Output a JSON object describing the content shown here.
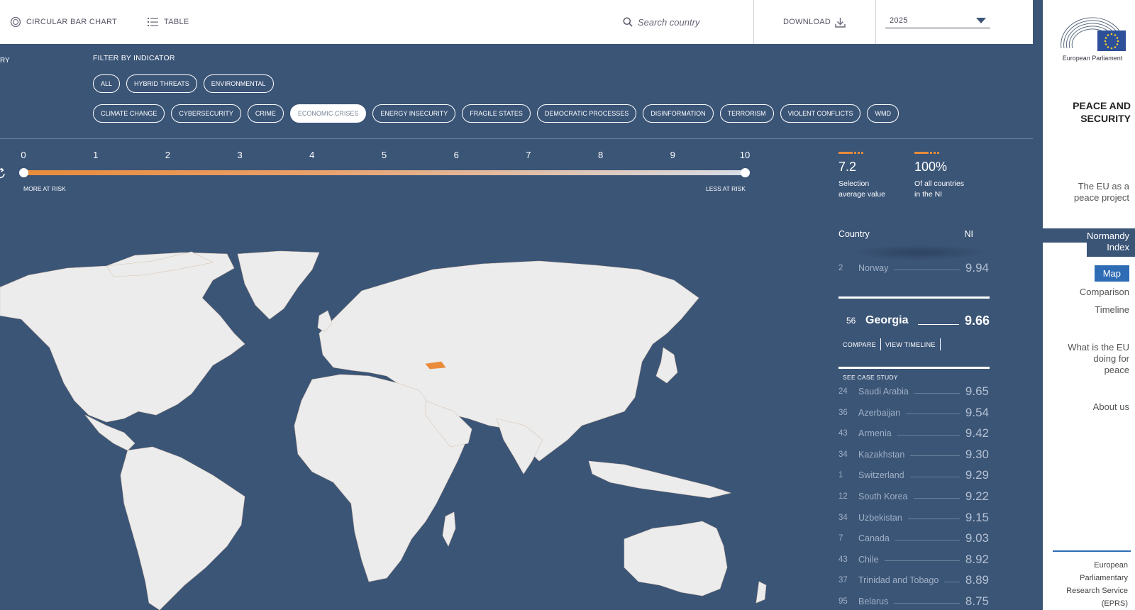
{
  "topbar": {
    "circular_label": "CIRCULAR BAR CHART",
    "table_label": "TABLE",
    "search_placeholder": "Search country",
    "download_label": "DOWNLOAD",
    "year": "2025"
  },
  "filters": {
    "cut_label": "RY",
    "heading": "FILTER BY INDICATOR",
    "row1": [
      "ALL",
      "HYBRID THREATS",
      "ENVIRONMENTAL"
    ],
    "row2": [
      "CLIMATE CHANGE",
      "CYBERSECURITY",
      "CRIME",
      "ECONOMIC CRISES",
      "ENERGY INSECURITY",
      "FRAGILE STATES",
      "DEMOCRATIC PROCESSES",
      "DISINFORMATION",
      "TERRORISM",
      "VIOLENT CONFLICTS",
      "WMD"
    ],
    "active": "ECONOMIC CRISES"
  },
  "scale": {
    "ticks": [
      "0",
      "1",
      "2",
      "3",
      "4",
      "5",
      "6",
      "7",
      "8",
      "9",
      "10"
    ],
    "left_label": "MORE AT RISK",
    "right_label": "LESS AT RISK",
    "range": [
      0,
      10
    ]
  },
  "stats": {
    "avg_value": "7.2",
    "avg_label_1": "Selection",
    "avg_label_2": "average value",
    "pct_value": "100%",
    "pct_label_1": "Of all countries",
    "pct_label_2": "in the NI"
  },
  "ranking": {
    "col_country": "Country",
    "col_ni": "NI",
    "above": [
      {
        "rank": "2",
        "name": "Norway",
        "value": "9.94"
      }
    ],
    "selected": {
      "rank": "56",
      "name": "Georgia",
      "value": "9.66",
      "compare": "COMPARE",
      "timeline": "VIEW TIMELINE",
      "case_study": "SEE CASE STUDY"
    },
    "below": [
      {
        "rank": "24",
        "name": "Saudi Arabia",
        "value": "9.65"
      },
      {
        "rank": "36",
        "name": "Azerbaijan",
        "value": "9.54"
      },
      {
        "rank": "43",
        "name": "Armenia",
        "value": "9.42"
      },
      {
        "rank": "34",
        "name": "Kazakhstan",
        "value": "9.30"
      },
      {
        "rank": "1",
        "name": "Switzerland",
        "value": "9.29"
      },
      {
        "rank": "12",
        "name": "South Korea",
        "value": "9.22"
      },
      {
        "rank": "34",
        "name": "Uzbekistan",
        "value": "9.15"
      },
      {
        "rank": "7",
        "name": "Canada",
        "value": "9.03"
      },
      {
        "rank": "43",
        "name": "Chile",
        "value": "8.92"
      },
      {
        "rank": "37",
        "name": "Trinidad and Tobago",
        "value": "8.89"
      },
      {
        "rank": "95",
        "name": "Belarus",
        "value": "8.75"
      }
    ]
  },
  "sidebar": {
    "ep_name": "European Parliament",
    "title_1": "PEACE AND",
    "title_2": "SECURITY",
    "eu_peace_1": "The EU as a",
    "eu_peace_2": "peace project",
    "normandy_1": "Normandy",
    "normandy_2": "Index",
    "map": "Map",
    "comparison": "Comparison",
    "timeline": "Timeline",
    "doing_1": "What is the EU",
    "doing_2": "doing for",
    "doing_3": "peace",
    "about": "About us",
    "eprs_1": "European",
    "eprs_2": "Parliamentary",
    "eprs_3": "Research Service",
    "eprs_4": "(EPRS)"
  },
  "colors": {
    "background": "#3b5577",
    "accent_orange": "#e98b3a",
    "land": "#ececec",
    "highlight_country": "#e98b3a",
    "nav_active": "#2e6cb5"
  },
  "icons": [
    "circular-chart-icon",
    "list-icon",
    "search-icon",
    "download-icon",
    "chevron-down-icon",
    "reset-icon",
    "eu-flag-icon"
  ]
}
